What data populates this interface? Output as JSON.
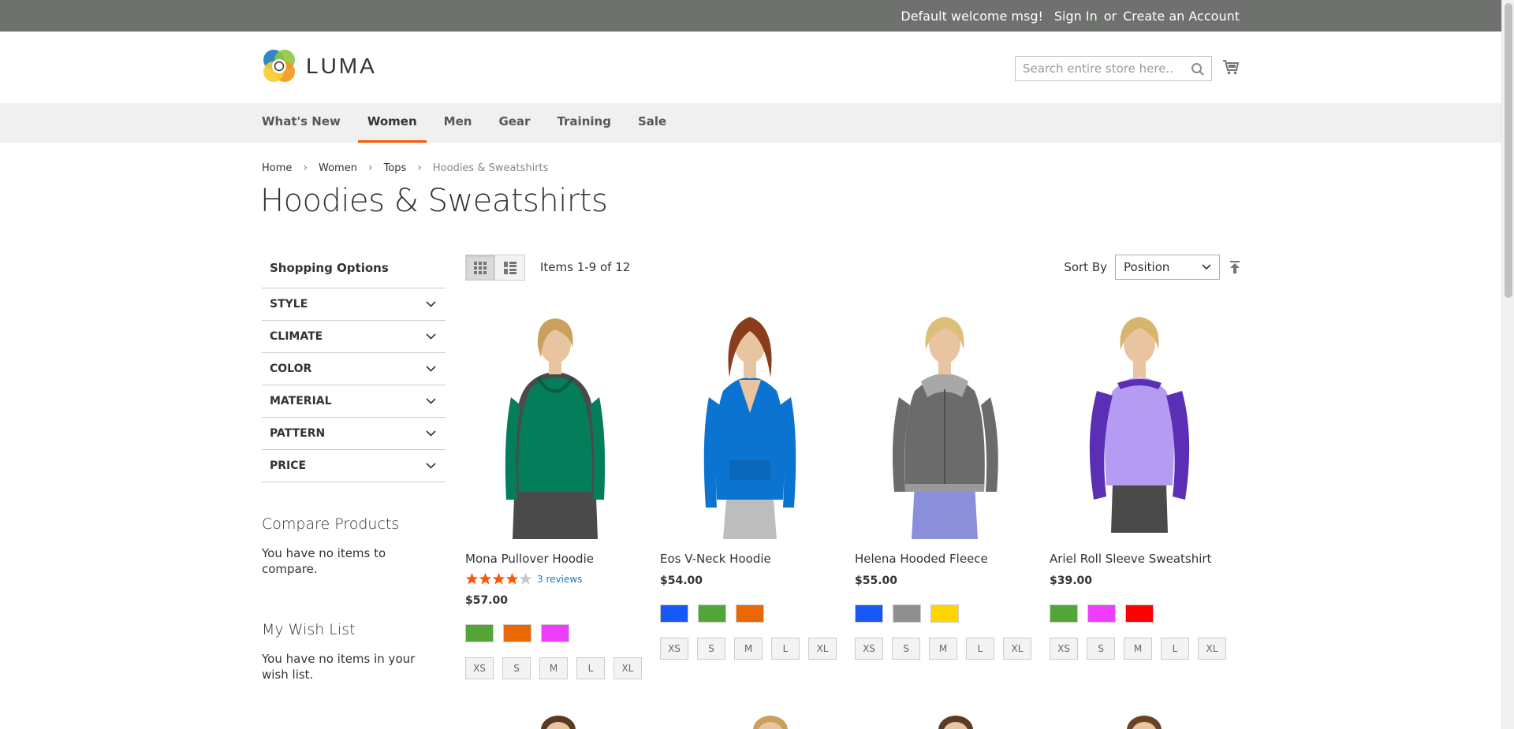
{
  "topbar": {
    "welcome": "Default welcome msg!",
    "sign_in": "Sign In",
    "or": "or",
    "create_account": "Create an Account"
  },
  "header": {
    "logo_text": "LUMA",
    "search_placeholder": "Search entire store here..."
  },
  "nav": {
    "items": [
      {
        "label": "What's New"
      },
      {
        "label": "Women"
      },
      {
        "label": "Men"
      },
      {
        "label": "Gear"
      },
      {
        "label": "Training"
      },
      {
        "label": "Sale"
      }
    ],
    "active": "Women"
  },
  "breadcrumb": {
    "items": [
      "Home",
      "Women",
      "Tops"
    ],
    "current": "Hoodies & Sweatshirts"
  },
  "page_title": "Hoodies & Sweatshirts",
  "sidebar": {
    "title": "Shopping Options",
    "filters": [
      "Style",
      "Climate",
      "Color",
      "Material",
      "Pattern",
      "Price"
    ],
    "compare_title": "Compare Products",
    "compare_text": "You have no items to compare.",
    "wishlist_title": "My Wish List",
    "wishlist_text": "You have no items in your wish list."
  },
  "toolbar": {
    "amount": "Items 1-9 of 12",
    "sort_label": "Sort By",
    "sort_value": "Position"
  },
  "products": [
    {
      "name": "Mona Pullover Hoodie",
      "rating": 4,
      "reviews": "3 reviews",
      "price": "$57.00",
      "swatches": [
        "#53a537",
        "#eb6703",
        "#ef3dff"
      ],
      "sizes": [
        "XS",
        "S",
        "M",
        "L",
        "XL"
      ]
    },
    {
      "name": "Eos V-Neck Hoodie",
      "price": "$54.00",
      "swatches": [
        "#1857f7",
        "#53a537",
        "#eb6703"
      ],
      "sizes": [
        "XS",
        "S",
        "M",
        "L",
        "XL"
      ]
    },
    {
      "name": "Helena Hooded Fleece",
      "price": "$55.00",
      "swatches": [
        "#1857f7",
        "#8f8f8f",
        "#ffd500"
      ],
      "sizes": [
        "XS",
        "S",
        "M",
        "L",
        "XL"
      ]
    },
    {
      "name": "Ariel Roll Sleeve Sweatshirt",
      "price": "$39.00",
      "swatches": [
        "#53a537",
        "#ef3dff",
        "#ff0000"
      ],
      "sizes": [
        "XS",
        "S",
        "M",
        "L",
        "XL"
      ]
    }
  ]
}
